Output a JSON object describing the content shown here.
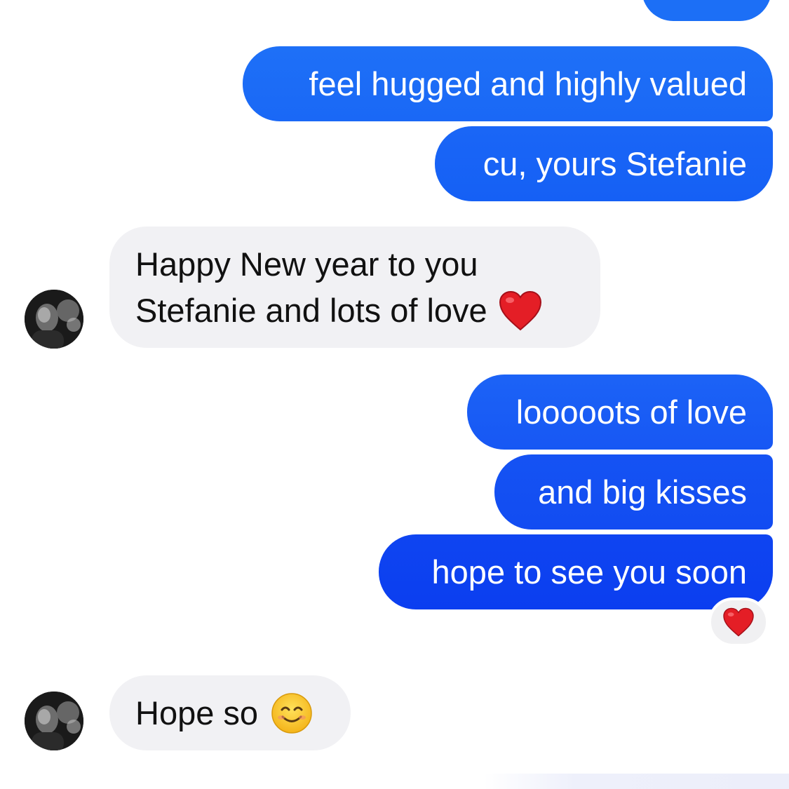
{
  "colors": {
    "outgoing_top": "#1a6cf6",
    "outgoing_bottom": "#0b3ff0",
    "incoming_bg": "#f1f1f4",
    "heart": "#e0202a",
    "smile": "#f7c531"
  },
  "messages": {
    "m1": "feel hugged and highly valued",
    "m2": "cu, yours Stefanie",
    "m3_line1": "Happy New year to you",
    "m3_line2": "Stefanie and lots of love",
    "m4": "looooots of love",
    "m5": "and big kisses",
    "m6": "hope to see you soon",
    "m7": "Hope so"
  },
  "icons": {
    "heart": "red-heart-emoji",
    "smile": "smiling-face-emoji"
  }
}
